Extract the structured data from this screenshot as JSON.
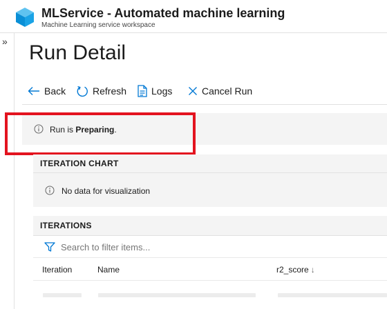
{
  "app": {
    "title": "MLService - Automated machine learning",
    "subtitle": "Machine Learning service workspace",
    "logo_icon": "cube-icon",
    "logo_color": "#0a8fd6"
  },
  "left_rail": {
    "expand_glyph": "»",
    "icon": "double-chevron-right-icon"
  },
  "page": {
    "title": "Run Detail"
  },
  "toolbar": {
    "back": "Back",
    "refresh": "Refresh",
    "logs": "Logs",
    "cancel": "Cancel Run",
    "icon_color": "#0078d4"
  },
  "status": {
    "prefix": "Run is ",
    "state": "Preparing",
    "suffix": ".",
    "highlight_color": "#e3131f"
  },
  "iteration_chart": {
    "heading": "ITERATION CHART",
    "empty_message": "No data for visualization"
  },
  "iterations": {
    "heading": "ITERATIONS",
    "filter_placeholder": "Search to filter items...",
    "columns": [
      {
        "label": "Iteration"
      },
      {
        "label": "Name"
      },
      {
        "label": "r2_score",
        "sort": "↓"
      }
    ]
  }
}
